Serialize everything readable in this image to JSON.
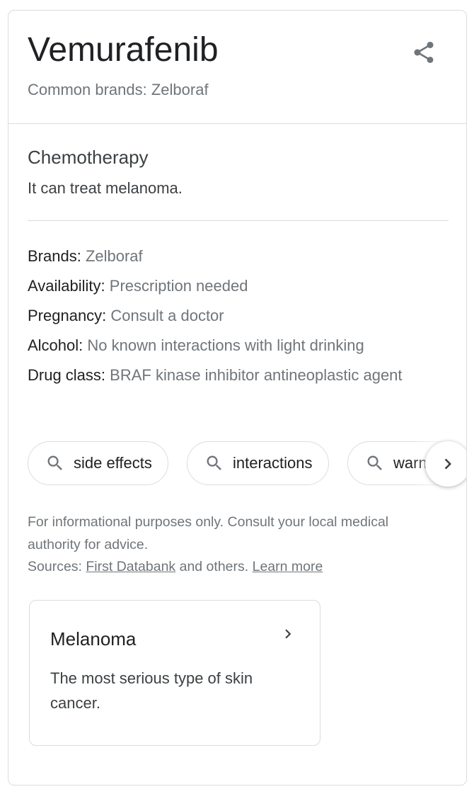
{
  "header": {
    "title": "Vemurafenib",
    "subtitle": "Common brands: Zelboraf",
    "share_icon": "share-icon"
  },
  "overview": {
    "category": "Chemotherapy",
    "description": "It can treat melanoma."
  },
  "facts": [
    {
      "label": "Brands:",
      "value": "Zelboraf"
    },
    {
      "label": "Availability:",
      "value": "Prescription needed"
    },
    {
      "label": "Pregnancy:",
      "value": "Consult a doctor"
    },
    {
      "label": "Alcohol:",
      "value": "No known interactions with light drinking"
    },
    {
      "label": "Drug class:",
      "value": "BRAF kinase inhibitor antineoplastic agent"
    }
  ],
  "chips": [
    {
      "label": "side effects",
      "icon": "search-icon"
    },
    {
      "label": "interactions",
      "icon": "search-icon"
    },
    {
      "label": "warnings",
      "icon": "search-icon"
    }
  ],
  "disclaimer": {
    "text": "For informational purposes only. Consult your local medical authority for advice.",
    "sources_prefix": "Sources:",
    "sources_link": "First Databank",
    "sources_middle": "and others.",
    "learn_more": "Learn more"
  },
  "related": {
    "title": "Melanoma",
    "description": "The most serious type of skin cancer."
  },
  "colors": {
    "text_primary": "#202124",
    "text_secondary": "#70757a",
    "border": "#dadce0"
  }
}
